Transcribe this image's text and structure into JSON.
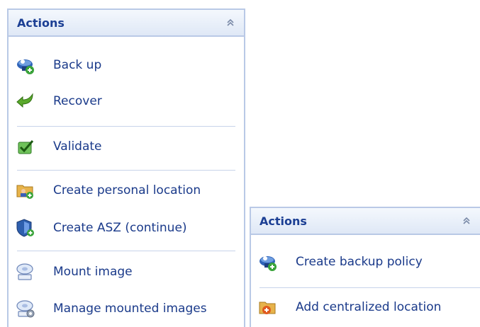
{
  "colors": {
    "header_text": "#1c3f94",
    "link_text": "#1a3a8a",
    "border": "#b9c9e6"
  },
  "left_panel": {
    "title": "Actions",
    "collapse_icon": "double-chevron-up-icon",
    "groups": [
      [
        {
          "label": "Back up",
          "icon": "backup-icon"
        },
        {
          "label": "Recover",
          "icon": "recover-arrow-icon"
        }
      ],
      [
        {
          "label": "Validate",
          "icon": "validate-check-icon"
        }
      ],
      [
        {
          "label": "Create personal location",
          "icon": "folder-user-icon"
        },
        {
          "label": "Create ASZ (continue)",
          "icon": "shield-icon"
        }
      ],
      [
        {
          "label": "Mount image",
          "icon": "disk-mount-icon"
        },
        {
          "label": "Manage mounted images",
          "icon": "disk-gear-icon"
        }
      ]
    ]
  },
  "right_panel": {
    "title": "Actions",
    "collapse_icon": "double-chevron-up-icon",
    "groups": [
      [
        {
          "label": "Create backup policy",
          "icon": "backup-icon"
        }
      ],
      [
        {
          "label": "Add centralized location",
          "icon": "folder-add-icon"
        }
      ]
    ]
  }
}
